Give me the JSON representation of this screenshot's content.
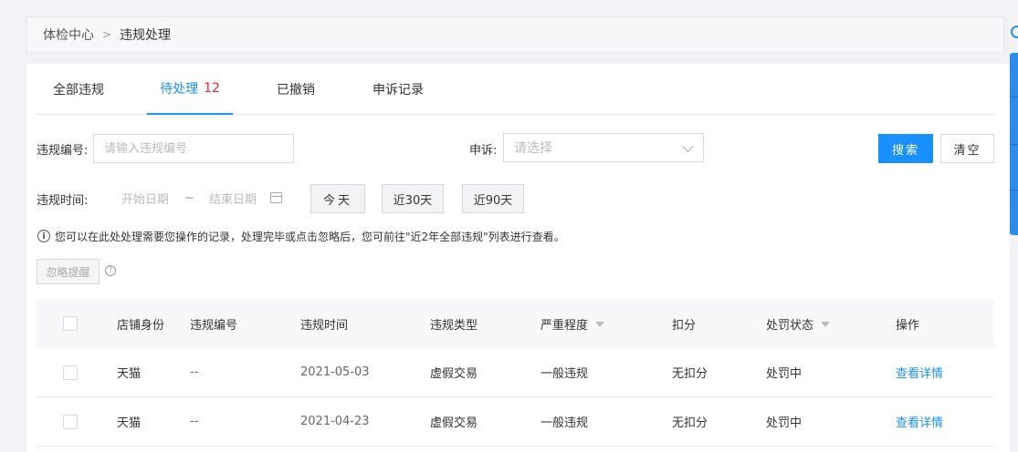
{
  "breadcrumb": {
    "root": "体检中心",
    "separator": ">",
    "current": "违规处理"
  },
  "tabs": [
    {
      "label": "全部违规"
    },
    {
      "label": "待处理",
      "badge": "12"
    },
    {
      "label": "已撤销"
    },
    {
      "label": "申诉记录"
    }
  ],
  "filters": {
    "violation_no_label": "违规编号:",
    "violation_no_placeholder": "请输入违规编号",
    "appeal_label": "申诉:",
    "appeal_placeholder": "请选择",
    "time_label": "违规时间:",
    "start_placeholder": "开始日期",
    "range_sep": "~",
    "end_placeholder": "结束日期",
    "today": "今天",
    "last30": "近30天",
    "last90": "近90天",
    "search": "搜索",
    "clear": "清空"
  },
  "notice": "您可以在此处处理需要您操作的记录，处理完毕或点击忽略后，您可前往\"近2年全部违规\"列表进行查看。",
  "ignore_button": "忽略提醒",
  "table": {
    "headers": [
      "店铺身份",
      "违规编号",
      "违规时间",
      "违规类型",
      "严重程度",
      "扣分",
      "处罚状态",
      "操作"
    ],
    "rows": [
      [
        "天猫",
        "--",
        "2021-05-03",
        "虚假交易",
        "一般违规",
        "无扣分",
        "处罚中",
        "查看详情"
      ],
      [
        "天猫",
        "--",
        "2021-04-23",
        "虚假交易",
        "一般违规",
        "无扣分",
        "处罚中",
        "查看详情"
      ]
    ]
  },
  "colors": {
    "primary": "#1890ff",
    "badge": "#f5222d"
  }
}
